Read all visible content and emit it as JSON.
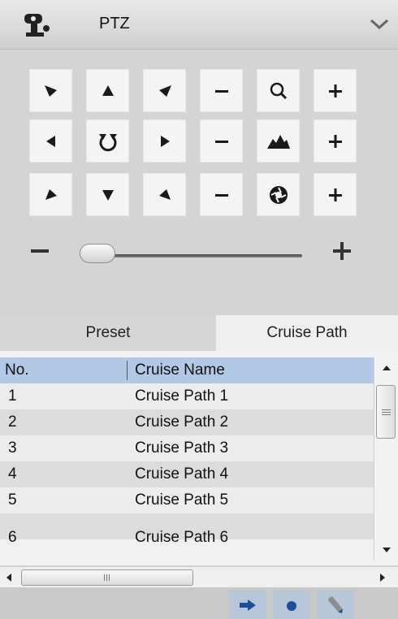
{
  "header": {
    "title": "PTZ",
    "icon": "joystick-icon",
    "collapse_icon": "chevron-down-icon"
  },
  "controls": {
    "grid": [
      [
        "arrow-up-left-icon",
        "arrow-up-icon",
        "arrow-up-right-icon",
        "minus-icon",
        "zoom-icon",
        "plus-icon"
      ],
      [
        "arrow-left-icon",
        "rotate-icon",
        "arrow-right-icon",
        "minus-icon",
        "focus-icon",
        "plus-icon"
      ],
      [
        "arrow-down-left-icon",
        "arrow-down-icon",
        "arrow-down-right-icon",
        "minus-icon",
        "iris-icon",
        "plus-icon"
      ]
    ],
    "speed_slider": {
      "value_fraction": 0.05
    }
  },
  "tabs": [
    {
      "label": "Preset",
      "active": false
    },
    {
      "label": "Cruise Path",
      "active": true
    }
  ],
  "table": {
    "columns": [
      "No.",
      "Cruise Name"
    ],
    "rows": [
      {
        "no": "1",
        "name": "Cruise Path 1"
      },
      {
        "no": "2",
        "name": "Cruise Path 2"
      },
      {
        "no": "3",
        "name": "Cruise Path 3"
      },
      {
        "no": "4",
        "name": "Cruise Path 4"
      },
      {
        "no": "5",
        "name": "Cruise Path 5"
      },
      {
        "no": "6",
        "name": "Cruise Path 6"
      }
    ]
  },
  "toolbar": {
    "buttons": [
      "call-arrow-icon",
      "record-dot-icon",
      "edit-pencil-icon"
    ]
  },
  "colors": {
    "header_bg": "#dcdcdc",
    "selected_header": "#b2c8e4",
    "toolbar_button": "#b8c7d8",
    "icon_dark": "#1a1a1a",
    "button_blue": "#1f4f9a"
  }
}
